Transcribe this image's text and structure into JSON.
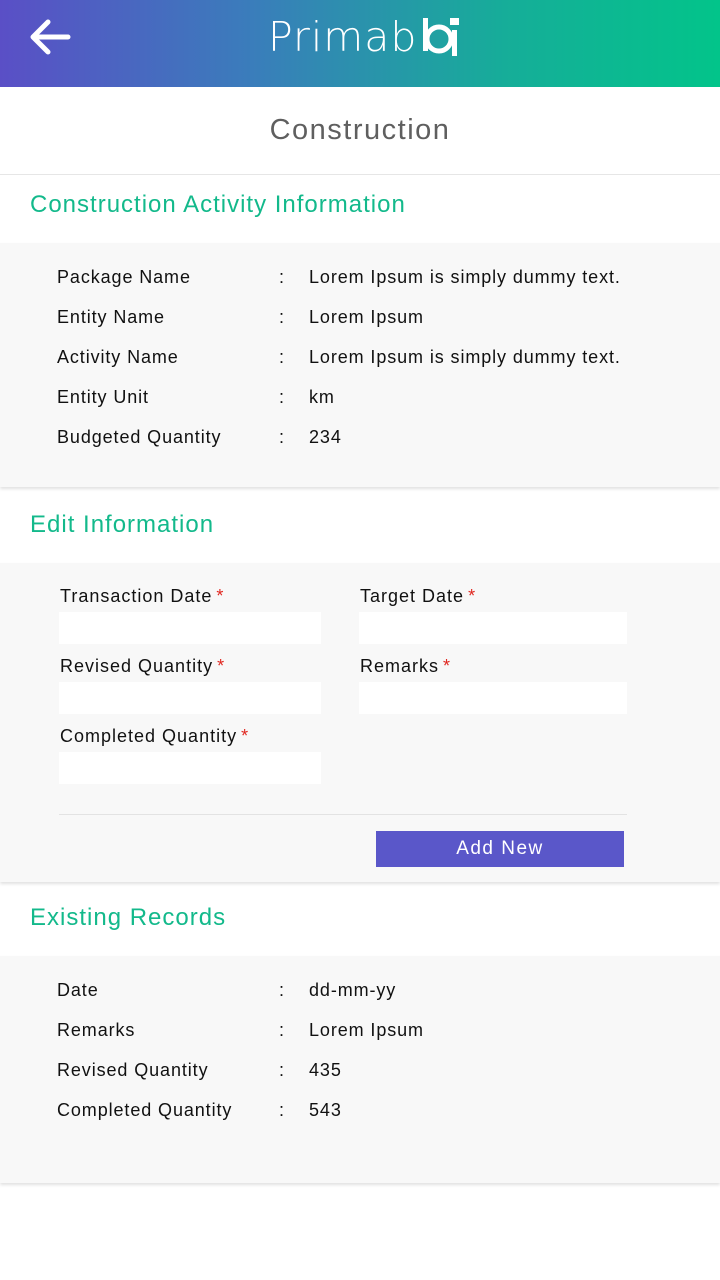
{
  "header": {
    "logo_text": "Primab",
    "logo_mark_text": "i",
    "accent_gradient": [
      "#5a4fc6",
      "#02c48a"
    ]
  },
  "page": {
    "title": "Construction"
  },
  "activity_info": {
    "heading": "Construction Activity Information",
    "rows": [
      {
        "label": "Package Name",
        "sep": ":",
        "value": "Lorem Ipsum is simply dummy text."
      },
      {
        "label": "Entity Name",
        "sep": ":",
        "value": "Lorem Ipsum"
      },
      {
        "label": "Activity Name",
        "sep": ":",
        "value": "Lorem Ipsum is simply dummy text."
      },
      {
        "label": "Entity Unit",
        "sep": ":",
        "value": "km"
      },
      {
        "label": "Budgeted Quantity",
        "sep": ":",
        "value": "234"
      }
    ]
  },
  "edit_info": {
    "heading": "Edit Information",
    "required_marker": "*",
    "fields": {
      "transaction_date": {
        "label": "Transaction Date",
        "value": "",
        "placeholder": ""
      },
      "target_date": {
        "label": "Target Date",
        "value": "",
        "placeholder": ""
      },
      "revised_quantity": {
        "label": "Revised Quantity",
        "value": "",
        "placeholder": ""
      },
      "remarks": {
        "label": "Remarks",
        "value": "",
        "placeholder": ""
      },
      "completed_quantity": {
        "label": "Completed Quantity",
        "value": "",
        "placeholder": ""
      }
    },
    "add_button_label": "Add New"
  },
  "existing_records": {
    "heading": "Existing Records",
    "rows": [
      {
        "label": "Date",
        "sep": ":",
        "value": "dd-mm-yy"
      },
      {
        "label": "Remarks",
        "sep": ":",
        "value": "Lorem Ipsum"
      },
      {
        "label": "Revised Quantity",
        "sep": ":",
        "value": "435"
      },
      {
        "label": "Completed Quantity",
        "sep": ":",
        "value": "543"
      }
    ]
  },
  "colors": {
    "section_heading": "#13b98b",
    "button": "#5a57c9",
    "required": "#e0261f"
  }
}
